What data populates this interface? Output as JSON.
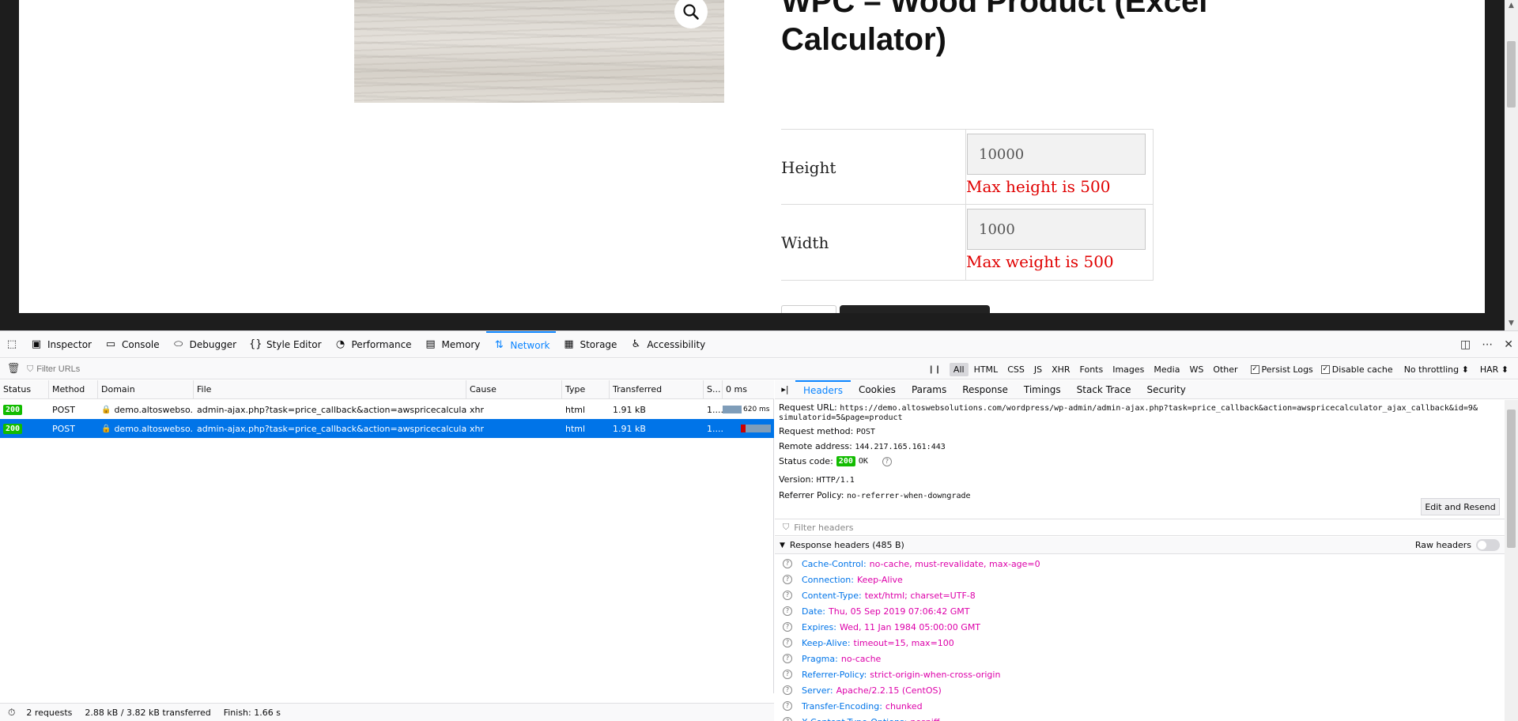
{
  "page": {
    "title": "WPC – Wood Product (Excel Calculator)",
    "height_label": "Height",
    "height_value": "10000",
    "height_error": "Max height is 500",
    "width_label": "Width",
    "width_value": "1000",
    "width_error": "Max weight is 500"
  },
  "devtools": {
    "tabs": [
      {
        "label": "Inspector",
        "icon": "inspector-icon"
      },
      {
        "label": "Console",
        "icon": "console-icon"
      },
      {
        "label": "Debugger",
        "icon": "debugger-icon"
      },
      {
        "label": "Style Editor",
        "icon": "style-editor-icon"
      },
      {
        "label": "Performance",
        "icon": "performance-icon"
      },
      {
        "label": "Memory",
        "icon": "memory-icon"
      },
      {
        "label": "Network",
        "icon": "network-icon",
        "selected": true
      },
      {
        "label": "Storage",
        "icon": "storage-icon"
      },
      {
        "label": "Accessibility",
        "icon": "accessibility-icon"
      }
    ],
    "toolbar": {
      "filter_placeholder": "Filter URLs",
      "types": [
        "All",
        "HTML",
        "CSS",
        "JS",
        "XHR",
        "Fonts",
        "Images",
        "Media",
        "WS",
        "Other"
      ],
      "persist_logs": "Persist Logs",
      "disable_cache": "Disable cache",
      "throttling": "No throttling ⬍",
      "har": "HAR ⬍"
    },
    "columns": {
      "status": "Status",
      "method": "Method",
      "domain": "Domain",
      "file": "File",
      "cause": "Cause",
      "type": "Type",
      "transferred": "Transferred",
      "size": "S...",
      "waterfall": "0 ms"
    },
    "requests": [
      {
        "status": "200",
        "method": "POST",
        "domain": "demo.altoswebso...",
        "file": "admin-ajax.php?task=price_callback&action=awspricecalculator_...",
        "cause": "xhr",
        "type": "html",
        "transferred": "1.91 kB",
        "size": "1....",
        "time": "620 ms"
      },
      {
        "status": "200",
        "method": "POST",
        "domain": "demo.altoswebso...",
        "file": "admin-ajax.php?task=price_callback&action=awspricecalculator_...",
        "cause": "xhr",
        "type": "html",
        "transferred": "1.91 kB",
        "size": "1...."
      }
    ],
    "summary": {
      "requests": "2 requests",
      "size": "2.88 kB / 3.82 kB transferred",
      "finish": "Finish: 1.66 s"
    },
    "details": {
      "tabs": [
        "Headers",
        "Cookies",
        "Params",
        "Response",
        "Timings",
        "Stack Trace",
        "Security"
      ],
      "request_url_label": "Request URL:",
      "request_url": "https://demo.altoswebsolutions.com/wordpress/wp-admin/admin-ajax.php?task=price_callback&action=awspricecalculator_ajax_callback&id=9&",
      "request_url_cont": "simulatorid=5&page=product",
      "method_label": "Request method:",
      "method": "POST",
      "remote_label": "Remote address:",
      "remote": "144.217.165.161:443",
      "status_label": "Status code:",
      "status_code": "200",
      "status_text": "OK",
      "version_label": "Version:",
      "version": "HTTP/1.1",
      "referrer_label": "Referrer Policy:",
      "referrer": "no-referrer-when-downgrade",
      "edit_resend": "Edit and Resend",
      "filter_headers": "Filter headers",
      "response_section": "Response headers (485 B)",
      "raw_headers": "Raw headers",
      "headers": [
        {
          "name": "Cache-Control:",
          "value": "no-cache, must-revalidate, max-age=0"
        },
        {
          "name": "Connection:",
          "value": "Keep-Alive"
        },
        {
          "name": "Content-Type:",
          "value": "text/html; charset=UTF-8"
        },
        {
          "name": "Date:",
          "value": "Thu, 05 Sep 2019 07:06:42 GMT"
        },
        {
          "name": "Expires:",
          "value": "Wed, 11 Jan 1984 05:00:00 GMT"
        },
        {
          "name": "Keep-Alive:",
          "value": "timeout=15, max=100"
        },
        {
          "name": "Pragma:",
          "value": "no-cache"
        },
        {
          "name": "Referrer-Policy:",
          "value": "strict-origin-when-cross-origin"
        },
        {
          "name": "Server:",
          "value": "Apache/2.2.15 (CentOS)"
        },
        {
          "name": "Transfer-Encoding:",
          "value": "chunked"
        },
        {
          "name": "X-Content-Type-Options:",
          "value": "nosniff"
        }
      ]
    }
  }
}
